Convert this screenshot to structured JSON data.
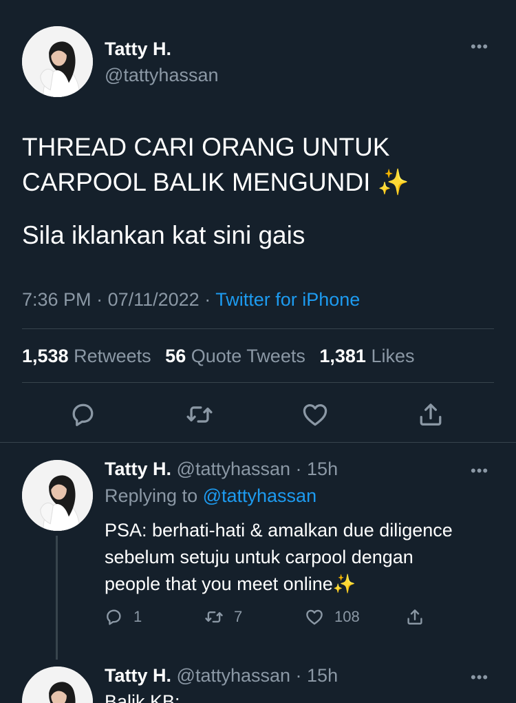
{
  "main_tweet": {
    "author_name": "Tatty H.",
    "author_handle": "@tattyhassan",
    "more_icon": "•••",
    "text_line1": "THREAD CARI ORANG UNTUK",
    "text_line2": "CARPOOL BALIK MENGUNDI",
    "sparkle": "✨",
    "text_para2": "Sila iklankan kat sini gais",
    "time": "7:36 PM",
    "sep1": " · ",
    "date": "07/11/2022",
    "sep2": " · ",
    "source": "Twitter for iPhone",
    "stats": {
      "retweets_count": "1,538",
      "retweets_label": "Retweets",
      "quotes_count": "56",
      "quotes_label": "Quote Tweets",
      "likes_count": "1,381",
      "likes_label": "Likes"
    },
    "actions": [
      "reply-icon",
      "retweet-icon",
      "like-icon",
      "share-icon"
    ]
  },
  "replies": [
    {
      "author_name": "Tatty H.",
      "author_handle": "@tattyhassan",
      "time_sep": " · ",
      "age": "15h",
      "replying_prefix": "Replying to ",
      "replying_to": "@tattyhassan",
      "body_line1": "PSA: berhati-hati & amalkan due diligence",
      "body_line2": "sebelum setuju untuk carpool dengan",
      "body_line3": "people that you meet online",
      "sparkle": "✨",
      "reply_count": "1",
      "retweet_count": "7",
      "like_count": "108"
    },
    {
      "author_name": "Tatty H.",
      "author_handle": "@tattyhassan",
      "time_sep": " · ",
      "age": "15h",
      "body_partial": "Balik KB:"
    }
  ],
  "colors": {
    "background": "#15202b",
    "text_primary": "#ffffff",
    "text_secondary": "#8b98a5",
    "accent": "#1d9bf0",
    "divider": "#38444d"
  }
}
